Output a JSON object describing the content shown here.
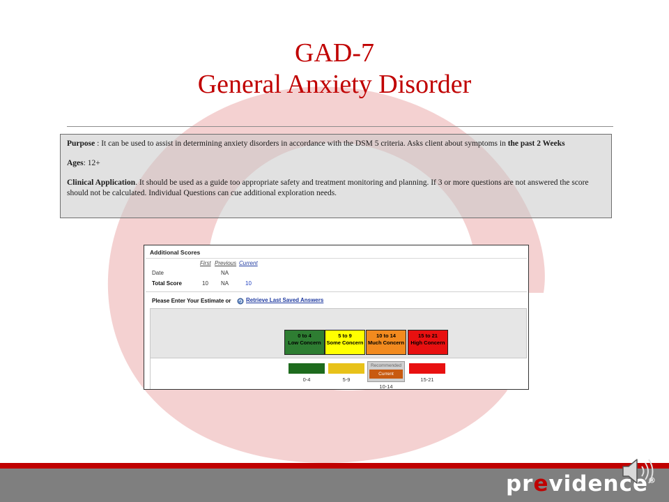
{
  "slide": {
    "title_line1": "GAD-7",
    "title_line2": "General Anxiety Disorder"
  },
  "info": {
    "purpose_label": "Purpose",
    "purpose_text": " : It can be used to assist in determining anxiety disorders in accordance with the DSM 5 criteria.  Asks client about symptoms in ",
    "purpose_bold": "the past 2 Weeks",
    "ages_label": "Ages",
    "ages_text": ": 12+",
    "clinical_label": "Clinical Application",
    "clinical_text": ".  It should be used as a guide too appropriate safety and treatment monitoring and planning.  If 3 or more questions are not answered the score should not be calculated.    Individual Questions can cue additional exploration needs."
  },
  "scores": {
    "header": "Additional Scores",
    "col_first": "First",
    "col_previous": "Previous",
    "col_current": "Current",
    "row_date_label": "Date",
    "row_date_previous": "NA",
    "row_total_label": "Total Score",
    "row_total_first": "10",
    "row_total_previous": "NA",
    "row_total_current": "10",
    "estimate_prompt": "Please Enter Your Estimate or",
    "retrieve_link": "Retrieve Last Saved Answers",
    "ranges": [
      {
        "range": "0 to 4",
        "label": "Low Concern",
        "color": "#2e7d32"
      },
      {
        "range": "5 to 9",
        "label": "Some Concern",
        "color": "#ffff00"
      },
      {
        "range": "10 to 14",
        "label": "Much Concern",
        "color": "#f28a1e"
      },
      {
        "range": "15 to 21",
        "label": "High Concern",
        "color": "#e81010"
      }
    ],
    "swatches": [
      {
        "label": "0-4",
        "color": "#1e6b1e"
      },
      {
        "label": "5-9",
        "color": "#e8c21a"
      },
      {
        "label": "10-14",
        "color": "#c85a10"
      },
      {
        "label": "15-21",
        "color": "#e81010"
      }
    ],
    "recommended_label": "Recommended",
    "current_label": "Current"
  },
  "footer": {
    "logo_pre": "pr",
    "logo_e": "e",
    "logo_post": "vidence",
    "logo_mark": "®"
  }
}
